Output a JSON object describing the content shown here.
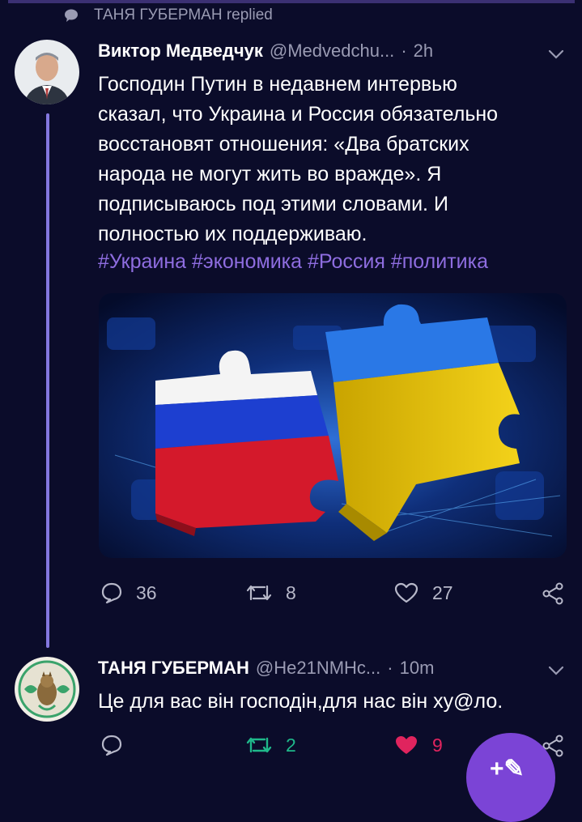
{
  "context": {
    "replied_label": "ТАНЯ ГУБЕРМАН replied"
  },
  "tweet1": {
    "author_name": "Виктор Медведчук",
    "author_handle": "@Medvedchu...",
    "separator": "·",
    "time": "2h",
    "text_lines": [
      "Господин Путин в недавнем интервью",
      "сказал, что Украина и Россия обязательно",
      "восстановят отношения: «Два братских",
      "народа не могут жить во вражде». Я",
      "подписываюсь под этими словами. И",
      "полностью их поддерживаю."
    ],
    "hashtags": "#Украина #экономика #Россия #политика",
    "actions": {
      "replies": "36",
      "retweets": "8",
      "likes": "27"
    }
  },
  "tweet2": {
    "author_name": "ТАНЯ ГУБЕРМАН",
    "author_handle": "@He21NMHc...",
    "separator": "·",
    "time": "10m",
    "text": "Це для вас він господін,для нас він ху@ло.",
    "actions": {
      "retweets": "2",
      "likes": "9"
    }
  },
  "fab": {
    "glyph": "+✎"
  },
  "colors": {
    "background": "#0b0c2a",
    "thread_line": "#9a8cff",
    "hashtag": "#8e6de0",
    "retweet_active": "#1fb88a",
    "like_active": "#e0245e",
    "fab": "#7b44d6"
  },
  "icons": [
    "chat-bubble-icon",
    "chevron-down-icon",
    "reply-icon",
    "retweet-icon",
    "heart-icon",
    "share-icon",
    "compose-icon"
  ]
}
